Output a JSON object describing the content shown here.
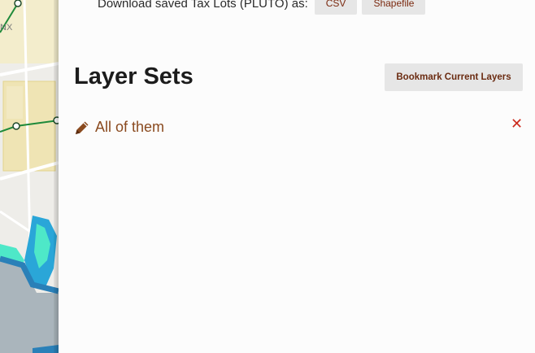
{
  "map": {
    "borough_label": "NX"
  },
  "download": {
    "label": "Download saved Tax Lots (PLUTO) as:",
    "csv_label": "CSV",
    "shapefile_label": "Shapefile"
  },
  "layer_sets": {
    "heading": "Layer Sets",
    "bookmark_label": "Bookmark Current Layers",
    "items": [
      {
        "name": "All of them",
        "icon": "pencil-icon",
        "remove_icon": "close-icon",
        "remove_glyph": "✕"
      }
    ]
  },
  "colors": {
    "accent_text": "#8a4a1f",
    "button_text": "#6b2c12",
    "remove": "#cc2b1e",
    "button_bg": "#e6e6e6"
  }
}
